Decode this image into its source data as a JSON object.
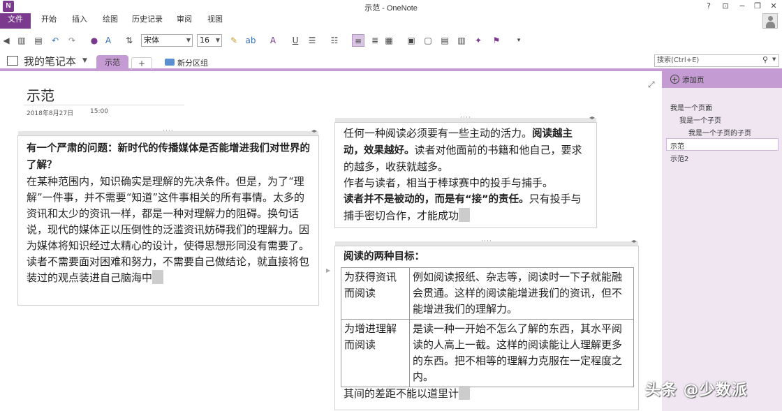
{
  "window": {
    "title": "示范 - OneNote",
    "logo": "N",
    "controls": [
      "?",
      "⊡",
      "−",
      "❐",
      "✕"
    ]
  },
  "menu": {
    "tabs": [
      "文件",
      "开始",
      "插入",
      "绘图",
      "历史记录",
      "审阅",
      "视图"
    ]
  },
  "toolbar": {
    "font_name": "宋体",
    "font_size": "16",
    "icons": [
      "back-icon",
      "dock-icon",
      "clipboard-icon",
      "undo-icon",
      "redo-icon",
      "paint-icon",
      "spelling-icon",
      "indent-icon",
      "highlight-icon",
      "spellcheck-icon",
      "font-color-icon",
      "underline-icon",
      "bullets-icon",
      "numbering-icon",
      "align-left-icon",
      "align-center-icon",
      "table-icon",
      "tag-icon",
      "insert-icon",
      "todo-icon",
      "more-icon"
    ]
  },
  "section_bar": {
    "notebook_name": "我的笔记本",
    "active_section": "示范",
    "add_tab": "+",
    "new_group": "新分区组",
    "search_placeholder": "搜索(Ctrl+E)"
  },
  "page": {
    "title": "示范",
    "date": "2018年8月27日",
    "time": "15:00"
  },
  "note1": {
    "bold": "有一个严肃的问题：新时代的传播媒体是否能增进我们对世界的了解？",
    "body": "在某种范围内，知识确实是理解的先决条件。但是，为了“理解”一件事，并不需要“知道”这件事相关的所有事情。太多的资讯和太少的资讯一样，都是一种对理解力的阻碍。换句话说，现代的媒体正以压倒性的泛滥资讯妨碍我们的理解力。因为媒体将知识经过太精心的设计，使得思想形同没有需要了。读者不需要面对困难和努力，不需要自己做结论，就直接将包装过的观点装进自己脑海中"
  },
  "note2": {
    "t1": "任何一种阅读必须要有一些主动的活力。",
    "b1": "阅读越主动，效果越好。",
    "t2": "读者对他面前的书籍和他自己，要求的越多，收获就越多。",
    "t3": "作者与读者，相当于棒球赛中的投手与捕手。",
    "b2": "读者并不是被动的，而是有“接”的责任。",
    "t4": "只有投手与捕手密切合作，才能成功"
  },
  "note3": {
    "heading": "阅读的两种目标：",
    "rows": [
      {
        "label": "为获得资讯而阅读",
        "desc": "例如阅读报纸、杂志等，阅读时一下子就能融会贯通。这样的阅读能增进我们的资讯，但不能增进我们的理解力。"
      },
      {
        "label": "为增进理解而阅读",
        "desc": "是读一种一开始不怎么了解的东西，其水平阅读的人高上一截。这样的阅读能让人理解更多的东西。把不相等的理解力克服在一定程度之内。"
      }
    ],
    "footer": "其间的差距不能以道里计"
  },
  "sidebar": {
    "add_page": "添加页",
    "pages": [
      {
        "label": "我是一个页面",
        "level": 0
      },
      {
        "label": "我是一个子页",
        "level": 1
      },
      {
        "label": "我是一个子页的子页",
        "level": 2
      },
      {
        "label": "示范",
        "level": 0,
        "selected": true
      },
      {
        "label": "示范2",
        "level": 0
      }
    ]
  },
  "watermark": "头条 @少数派",
  "colors": {
    "accent": "#7c3a8f",
    "section_tab": "#c59bd4",
    "sidebar_bg": "#efe6f2"
  }
}
